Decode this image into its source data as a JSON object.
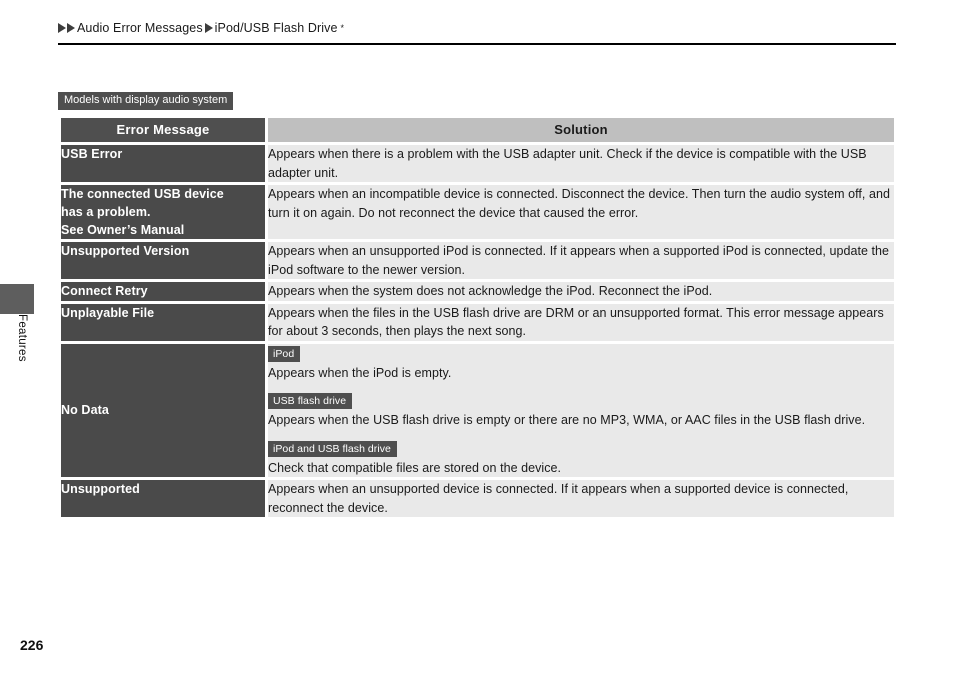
{
  "breadcrumb": {
    "level1": "Audio Error Messages",
    "level2": "iPod/USB Flash Drive",
    "superscript": "*"
  },
  "sidebar": {
    "tab_label": "Features"
  },
  "models_badge": "Models with display audio system",
  "table": {
    "headers": {
      "message": "Error Message",
      "solution": "Solution"
    },
    "rows": [
      {
        "message": "USB Error",
        "solution": "Appears when there is a problem with the USB adapter unit. Check if the device is compatible with the USB adapter unit."
      },
      {
        "message_line1": "The connected USB device",
        "message_line2": "has a problem.",
        "message_line3": "See Owner’s Manual",
        "solution": "Appears when an incompatible device is connected. Disconnect the device. Then turn the audio system off, and turn it on again. Do not reconnect the device that caused the error."
      },
      {
        "message": "Unsupported Version",
        "solution": "Appears when an unsupported iPod is connected. If it appears when a supported iPod is connected, update the iPod software to the newer version."
      },
      {
        "message": "Connect Retry",
        "solution": "Appears when the system does not acknowledge the iPod. Reconnect the iPod."
      },
      {
        "message": "Unplayable File",
        "solution": "Appears when the files in the USB flash drive are DRM or an unsupported format. This error message appears for about 3 seconds, then plays the next song."
      },
      {
        "message": "No Data",
        "blocks": [
          {
            "badge": "iPod",
            "text": "Appears when the iPod is empty."
          },
          {
            "badge": "USB flash drive",
            "text": "Appears when the USB flash drive is empty or there are no MP3, WMA, or AAC files in the USB flash drive."
          },
          {
            "badge": "iPod and USB flash drive",
            "text": "Check that compatible files are stored on the device."
          }
        ]
      },
      {
        "message": "Unsupported",
        "solution": "Appears when an unsupported device is connected. If it appears when a supported device is connected, reconnect the device."
      }
    ]
  },
  "page_number": "226",
  "colors": {
    "dark_cell": "#4a4a4a",
    "badge": "#4f4f4f",
    "header_solution": "#bfbfbf",
    "solution_cell": "#e9e9e9",
    "rule": "#000000"
  }
}
